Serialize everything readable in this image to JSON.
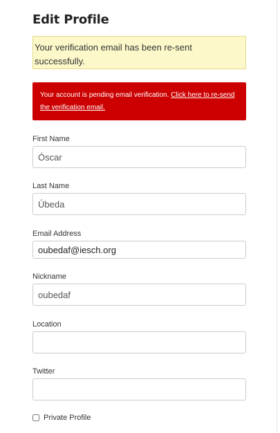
{
  "page": {
    "title": "Edit Profile"
  },
  "alerts": {
    "success": "Your verification email has been re-sent successfully.",
    "danger_text": "Your account is pending email verification. ",
    "danger_link": "Click here to re-send the verification email."
  },
  "form": {
    "first_name": {
      "label": "First Name",
      "value": "Óscar"
    },
    "last_name": {
      "label": "Last Name",
      "value": "Úbeda"
    },
    "email": {
      "label": "Email Address",
      "value": "oubedaf@iesch.org"
    },
    "nickname": {
      "label": "Nickname",
      "value": "oubedaf"
    },
    "location": {
      "label": "Location",
      "value": ""
    },
    "twitter": {
      "label": "Twitter",
      "value": ""
    },
    "private_profile": {
      "label": "Private Profile",
      "checked": false
    }
  },
  "colors": {
    "success_bg": "#fcf8c9",
    "danger_bg": "#cc0000"
  }
}
